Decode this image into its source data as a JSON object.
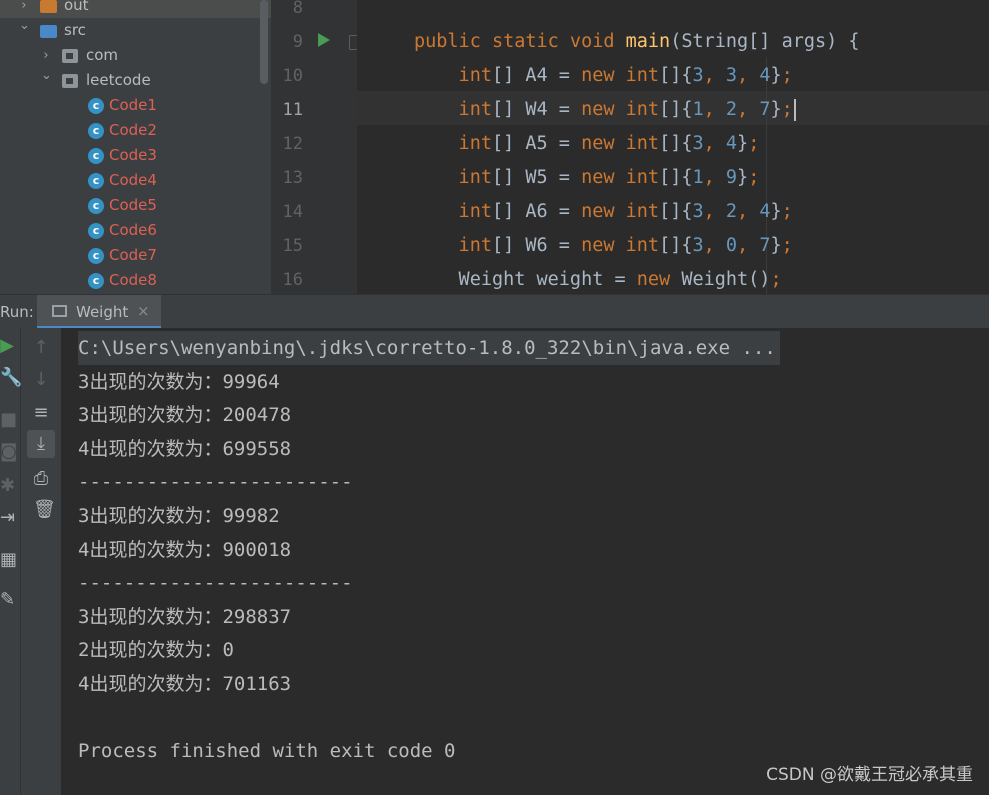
{
  "tree": {
    "items": [
      {
        "label": "out",
        "type": "folder-orange",
        "arrow": "›"
      },
      {
        "label": "src",
        "type": "folder-blue",
        "arrow": "⌄"
      },
      {
        "label": "com",
        "type": "package",
        "arrow": "›"
      },
      {
        "label": "leetcode",
        "type": "package",
        "arrow": "⌄"
      },
      {
        "label": "Code1",
        "type": "class"
      },
      {
        "label": "Code2",
        "type": "class"
      },
      {
        "label": "Code3",
        "type": "class"
      },
      {
        "label": "Code4",
        "type": "class"
      },
      {
        "label": "Code5",
        "type": "class"
      },
      {
        "label": "Code6",
        "type": "class"
      },
      {
        "label": "Code7",
        "type": "class"
      },
      {
        "label": "Code8",
        "type": "class"
      }
    ]
  },
  "editor": {
    "line_numbers": [
      "8",
      "9",
      "10",
      "11",
      "12",
      "13",
      "14",
      "15",
      "16"
    ],
    "active_line": "11",
    "lines": [
      {
        "n": "8",
        "tokens": []
      },
      {
        "n": "9",
        "tokens": [
          {
            "t": "public static void ",
            "c": "kw"
          },
          {
            "t": "main",
            "c": "fn"
          },
          {
            "t": "(String[] args) {",
            "c": ""
          }
        ]
      },
      {
        "n": "10",
        "tokens": [
          {
            "t": "    int",
            "c": "kw"
          },
          {
            "t": "[] A4 = ",
            "c": ""
          },
          {
            "t": "new ",
            "c": "kw"
          },
          {
            "t": "int",
            "c": "kw"
          },
          {
            "t": "[]{",
            "c": ""
          },
          {
            "t": "3",
            "c": "num"
          },
          {
            "t": ", ",
            "c": "kw"
          },
          {
            "t": "3",
            "c": "num"
          },
          {
            "t": ", ",
            "c": "kw"
          },
          {
            "t": "4",
            "c": "num"
          },
          {
            "t": "}",
            "c": ""
          },
          {
            "t": ";",
            "c": "kw"
          }
        ]
      },
      {
        "n": "11",
        "tokens": [
          {
            "t": "    int",
            "c": "kw"
          },
          {
            "t": "[] W4 = ",
            "c": ""
          },
          {
            "t": "new ",
            "c": "kw"
          },
          {
            "t": "int",
            "c": "kw"
          },
          {
            "t": "[]{",
            "c": ""
          },
          {
            "t": "1",
            "c": "num"
          },
          {
            "t": ", ",
            "c": "kw"
          },
          {
            "t": "2",
            "c": "num"
          },
          {
            "t": ", ",
            "c": "kw"
          },
          {
            "t": "7",
            "c": "num"
          },
          {
            "t": "}",
            "c": ""
          },
          {
            "t": ";",
            "c": "kw"
          }
        ],
        "caret": true
      },
      {
        "n": "12",
        "tokens": [
          {
            "t": "    int",
            "c": "kw"
          },
          {
            "t": "[] A5 = ",
            "c": ""
          },
          {
            "t": "new ",
            "c": "kw"
          },
          {
            "t": "int",
            "c": "kw"
          },
          {
            "t": "[]{",
            "c": ""
          },
          {
            "t": "3",
            "c": "num"
          },
          {
            "t": ", ",
            "c": "kw"
          },
          {
            "t": "4",
            "c": "num"
          },
          {
            "t": "}",
            "c": ""
          },
          {
            "t": ";",
            "c": "kw"
          }
        ]
      },
      {
        "n": "13",
        "tokens": [
          {
            "t": "    int",
            "c": "kw"
          },
          {
            "t": "[] W5 = ",
            "c": ""
          },
          {
            "t": "new ",
            "c": "kw"
          },
          {
            "t": "int",
            "c": "kw"
          },
          {
            "t": "[]{",
            "c": ""
          },
          {
            "t": "1",
            "c": "num"
          },
          {
            "t": ", ",
            "c": "kw"
          },
          {
            "t": "9",
            "c": "num"
          },
          {
            "t": "}",
            "c": ""
          },
          {
            "t": ";",
            "c": "kw"
          }
        ]
      },
      {
        "n": "14",
        "tokens": [
          {
            "t": "    int",
            "c": "kw"
          },
          {
            "t": "[] A6 = ",
            "c": ""
          },
          {
            "t": "new ",
            "c": "kw"
          },
          {
            "t": "int",
            "c": "kw"
          },
          {
            "t": "[]{",
            "c": ""
          },
          {
            "t": "3",
            "c": "num"
          },
          {
            "t": ", ",
            "c": "kw"
          },
          {
            "t": "2",
            "c": "num"
          },
          {
            "t": ", ",
            "c": "kw"
          },
          {
            "t": "4",
            "c": "num"
          },
          {
            "t": "}",
            "c": ""
          },
          {
            "t": ";",
            "c": "kw"
          }
        ]
      },
      {
        "n": "15",
        "tokens": [
          {
            "t": "    int",
            "c": "kw"
          },
          {
            "t": "[] W6 = ",
            "c": ""
          },
          {
            "t": "new ",
            "c": "kw"
          },
          {
            "t": "int",
            "c": "kw"
          },
          {
            "t": "[]{",
            "c": ""
          },
          {
            "t": "3",
            "c": "num"
          },
          {
            "t": ", ",
            "c": "kw"
          },
          {
            "t": "0",
            "c": "num"
          },
          {
            "t": ", ",
            "c": "kw"
          },
          {
            "t": "7",
            "c": "num"
          },
          {
            "t": "}",
            "c": ""
          },
          {
            "t": ";",
            "c": "kw"
          }
        ]
      },
      {
        "n": "16",
        "tokens": [
          {
            "t": "    Weight weight = ",
            "c": ""
          },
          {
            "t": "new ",
            "c": "kw"
          },
          {
            "t": "Weight()",
            "c": ""
          },
          {
            "t": ";",
            "c": "kw"
          }
        ]
      }
    ]
  },
  "run_panel": {
    "label": "Run:",
    "tab_label": "Weight",
    "tab_close": "×"
  },
  "console": {
    "lines": [
      "C:\\Users\\wenyanbing\\.jdks\\corretto-1.8.0_322\\bin\\java.exe ...",
      "3出现的次数为：99964",
      "3出现的次数为：200478",
      "4出现的次数为：699558",
      "------------------------",
      "3出现的次数为：99982",
      "4出现的次数为：900018",
      "------------------------",
      "3出现的次数为：298837",
      "2出现的次数为：0",
      "4出现的次数为：701163",
      "",
      "Process finished with exit code 0"
    ]
  },
  "watermark": "CSDN @欲戴王冠必承其重",
  "colors": {
    "keyword": "#cc7832",
    "number": "#6897bb",
    "function": "#ffc66d",
    "text": "#a9b7c6",
    "red_file": "#dc6154",
    "run_green": "#499c54"
  },
  "icons": {
    "run_toolbar": [
      "run-icon",
      "wrench-icon",
      "stop-icon",
      "camera-icon",
      "settings-icon",
      "login-icon",
      "layout-icon",
      "pin-icon"
    ],
    "console_toolbar": [
      "up-arrow-icon",
      "down-arrow-icon",
      "soft-wrap-icon",
      "scroll-to-end-icon",
      "print-icon",
      "trash-icon"
    ]
  }
}
